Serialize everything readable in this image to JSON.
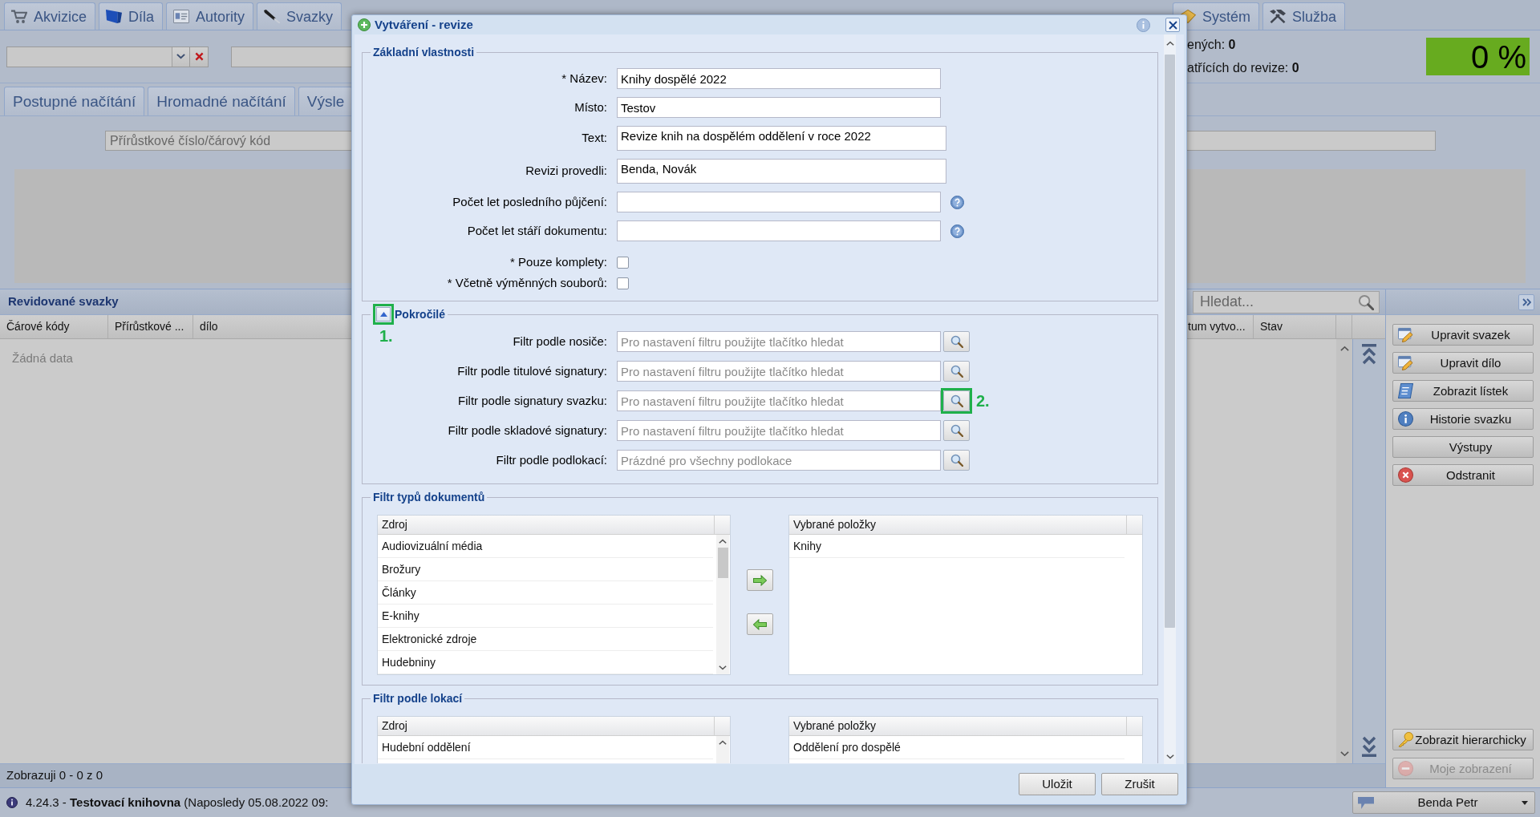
{
  "main_tabs": [
    "Akvizice",
    "Díla",
    "Autority",
    "Svazky",
    "Systém",
    "Služba"
  ],
  "toolbar": {
    "stats": [
      "ených: **0**",
      "atřících do revize: **0**"
    ],
    "progress_text": "0 %"
  },
  "sub_tabs": [
    "Postupné načítání",
    "Hromadné načítání",
    "Výsle"
  ],
  "barcode_field": {
    "placeholder": "Přírůstkové číslo/čárový kód"
  },
  "volumes_panel": {
    "title": "Revidované svazky",
    "search_placeholder": "Hledat...",
    "columns": [
      "Čárové kódy",
      "Přírůstkové ...",
      "dílo",
      "tum vytvo...",
      "Stav"
    ],
    "empty_text": "Žádná data",
    "footer": "Zobrazuji 0 - 0 z 0"
  },
  "actions": [
    {
      "label": "Upravit svazek",
      "disabled": false
    },
    {
      "label": "Upravit dílo",
      "disabled": false
    },
    {
      "label": "Zobrazit lístek",
      "disabled": false
    },
    {
      "label": "Historie svazku",
      "disabled": false
    },
    {
      "label": "Výstupy",
      "disabled": false
    },
    {
      "label": "Odstranit",
      "disabled": false
    }
  ],
  "bottom_actions": [
    {
      "label": "Zobrazit hierarchicky",
      "disabled": false
    },
    {
      "label": "Moje zobrazení",
      "disabled": true
    }
  ],
  "status_bar": {
    "text": "4.24.3 - **Testovací knihovna** (Naposledy 05.08.2022 09:",
    "user": "Benda Petr"
  },
  "dialog": {
    "title": "Vytváření - revize",
    "basic": {
      "legend": "Základní vlastnosti",
      "fields": [
        {
          "kind": "text",
          "label": "* Název:",
          "value": "Knihy dospělé 2022"
        },
        {
          "kind": "text",
          "label": "Místo:",
          "value": "Testov"
        },
        {
          "kind": "textarea",
          "label": "Text:",
          "value": "Revize knih na dospělém oddělení v roce 2022"
        },
        {
          "kind": "textarea",
          "label": "Revizi provedli:",
          "value": "Benda, Novák"
        },
        {
          "kind": "text_help",
          "label": "Počet let posledního půjčení:"
        },
        {
          "kind": "text_help",
          "label": "Počet let stáří dokumentu:"
        },
        {
          "kind": "checkbox",
          "label": "* Pouze komplety:",
          "checked": false
        },
        {
          "kind": "checkbox",
          "label": "* Včetně výměnných souborů:",
          "checked": false
        }
      ]
    },
    "advanced": {
      "legend": "Pokročilé",
      "expanded": true,
      "annotation": "1.",
      "filters": [
        {
          "label": "Filtr podle nosiče:",
          "placeholder": "Pro nastavení filtru použijte tlačítko hledat"
        },
        {
          "label": "Filtr podle titulové signatury:",
          "placeholder": "Pro nastavení filtru použijte tlačítko hledat"
        },
        {
          "label": "Filtr podle signatury svazku:",
          "placeholder": "Pro nastavení filtru použijte tlačítko hledat",
          "annotation": "2."
        },
        {
          "label": "Filtr podle skladové signatury:",
          "placeholder": "Pro nastavení filtru použijte tlačítko hledat"
        },
        {
          "label": "Filtr podle podlokací:",
          "placeholder": "Prázdné pro všechny podlokace"
        }
      ]
    },
    "document_types": {
      "legend": "Filtr typů dokumentů",
      "source": {
        "header": "Zdroj",
        "items": [
          "Audiovizuální média",
          "Brožury",
          "Články",
          "E-knihy",
          "Elektronické zdroje",
          "Hudebniny"
        ]
      },
      "chosen": {
        "header": "Vybrané položky",
        "items": [
          "Knihy"
        ]
      }
    },
    "locations": {
      "legend": "Filtr podle lokací",
      "source": {
        "header": "Zdroj",
        "items": [
          "Hudební oddělení"
        ]
      },
      "chosen": {
        "header": "Vybrané položky",
        "items": [
          "Oddělení pro dospělé"
        ]
      }
    },
    "buttons": [
      "Uložit",
      "Zrušit"
    ]
  }
}
